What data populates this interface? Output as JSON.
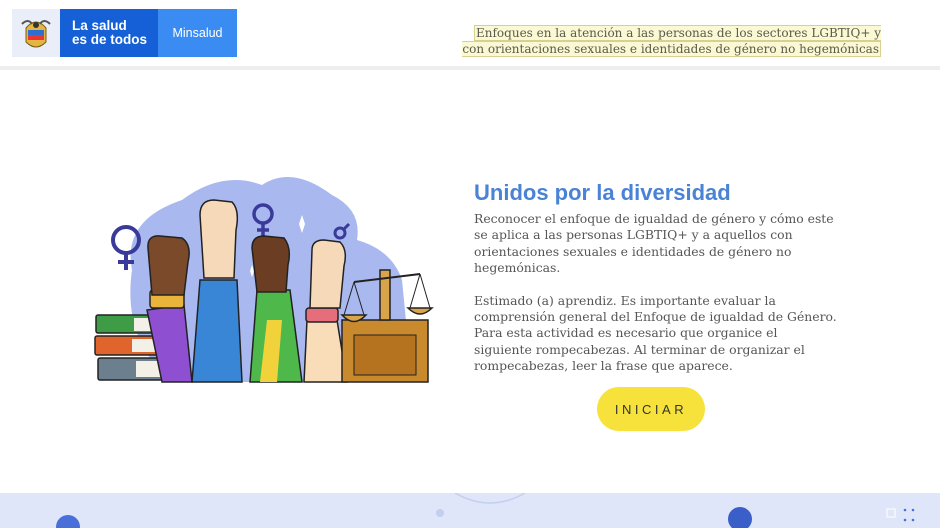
{
  "header": {
    "logo": {
      "line1": "La salud",
      "line2": "es de todos",
      "brand": "Minsalud"
    },
    "course_title": "Enfoques en la atención a las personas de los sectores LGBTIQ+ y con orientaciones sexuales e identidades de género no hegemónicas"
  },
  "main": {
    "heading": "Unidos por la diversidad",
    "intro": "Reconocer el enfoque de igualdad de género y cómo este se aplica a las personas LGBTIQ+ y a aquellos con orientaciones sexuales e identidades de género no hegemónicas.",
    "instructions": "Estimado (a) aprendiz. Es importante evaluar la comprensión general del Enfoque de igualdad de Género.  Para esta actividad es necesario que organice el siguiente rompecabezas. Al terminar de organizar el rompecabezas, leer la frase que aparece.",
    "start_button": "INICIAR"
  },
  "colors": {
    "brand_blue": "#1560d6",
    "brand_light_blue": "#3b8cf2",
    "heading_blue": "#4a83d6",
    "button_yellow": "#f7e13b"
  },
  "icons": [
    "colombia-shield-icon",
    "diversity-hands-illustration",
    "venus-symbol-icon",
    "mars-symbol-icon",
    "scales-of-justice-icon",
    "expand-icon",
    "grid-icon"
  ]
}
